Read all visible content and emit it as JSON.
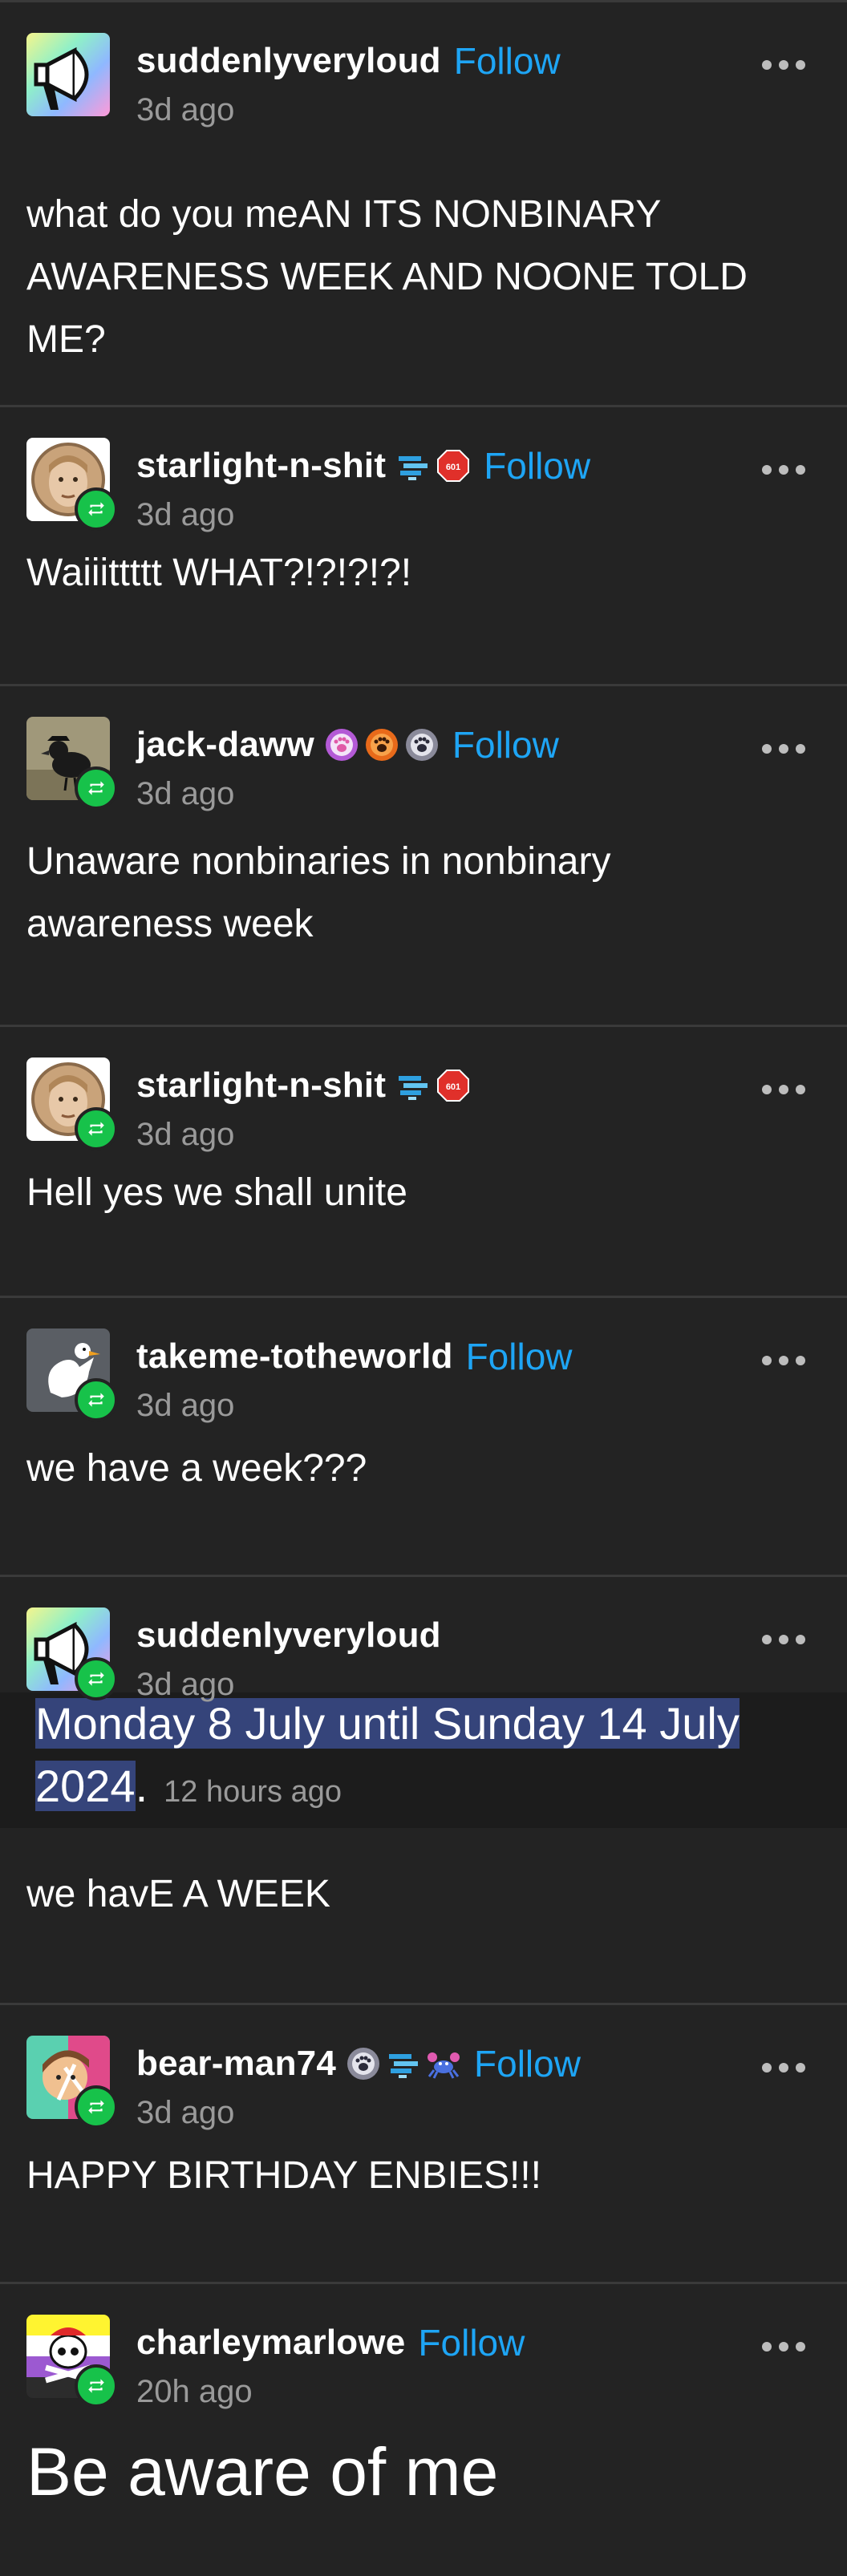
{
  "posts": [
    {
      "username": "suddenlyveryloud",
      "follow": "Follow",
      "time": "3d ago",
      "text": "what do you meAN ITS NONBINARY AWARENESS WEEK AND NOONE TOLD ME?"
    },
    {
      "username": "starlight-n-shit",
      "follow": "Follow",
      "time": "3d ago",
      "text": "Waiiittttt WHAT?!?!?!?!",
      "badges": [
        "sound-wave-badge",
        "octagon-badge"
      ]
    },
    {
      "username": "jack-daww",
      "follow": "Follow",
      "time": "3d ago",
      "text": "Unaware nonbinaries in nonbinary awareness week",
      "badges": [
        "paw-badge-purple",
        "paw-badge-orange",
        "paw-badge-grey"
      ]
    },
    {
      "username": "starlight-n-shit",
      "time": "3d ago",
      "text": "Hell yes we shall unite",
      "badges": [
        "sound-wave-badge",
        "octagon-badge"
      ]
    },
    {
      "username": "takeme-totheworld",
      "follow": "Follow",
      "time": "3d ago",
      "text": "we have a week???"
    },
    {
      "username": "suddenlyveryloud",
      "time": "3d ago",
      "quote_highlight": "Monday 8 July until Sunday 14 July 2024",
      "quote_period": ".",
      "quote_time": "12 hours ago",
      "text": "we havE A WEEK"
    },
    {
      "username": "bear-man74",
      "follow": "Follow",
      "time": "3d ago",
      "text": "HAPPY BIRTHDAY ENBIES!!!",
      "badges": [
        "paw-badge-grey",
        "sound-wave-badge",
        "crab-badge"
      ]
    },
    {
      "username": "charleymarlowe",
      "follow": "Follow",
      "time": "20h ago",
      "text": "Be aware of me"
    }
  ],
  "badge_values": {
    "octagon": "601"
  },
  "colors": {
    "background": "#232323",
    "follow": "#1ea5f5",
    "reblog": "#17c24a",
    "highlight": "#35447a"
  }
}
